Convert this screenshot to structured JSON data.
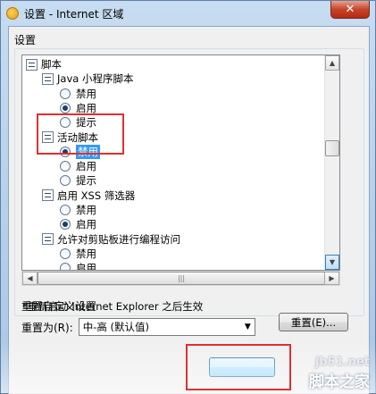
{
  "window": {
    "title": "设置 - Internet 区域",
    "close_symbol": "✕"
  },
  "settings_label": "设置",
  "tree": [
    {
      "type": "section",
      "label": "脚本",
      "indent": 0
    },
    {
      "type": "section",
      "label": "Java 小程序脚本",
      "indent": 1
    },
    {
      "type": "radio",
      "label": "禁用",
      "indent": 2,
      "checked": false
    },
    {
      "type": "radio",
      "label": "启用",
      "indent": 2,
      "checked": true
    },
    {
      "type": "radio",
      "label": "提示",
      "indent": 2,
      "checked": false
    },
    {
      "type": "section",
      "label": "活动脚本",
      "indent": 1
    },
    {
      "type": "radio",
      "label": "禁用",
      "indent": 2,
      "checked": true,
      "selected": true
    },
    {
      "type": "radio",
      "label": "启用",
      "indent": 2,
      "checked": false
    },
    {
      "type": "radio",
      "label": "提示",
      "indent": 2,
      "checked": false
    },
    {
      "type": "section",
      "label": "启用 XSS 筛选器",
      "indent": 1
    },
    {
      "type": "radio",
      "label": "禁用",
      "indent": 2,
      "checked": false
    },
    {
      "type": "radio",
      "label": "启用",
      "indent": 2,
      "checked": true
    },
    {
      "type": "section",
      "label": "允许对剪贴板进行编程访问",
      "indent": 1
    },
    {
      "type": "radio",
      "label": "禁用",
      "indent": 2,
      "checked": false
    },
    {
      "type": "radio",
      "label": "启用",
      "indent": 2,
      "checked": false
    }
  ],
  "note": "*重新启动 Internet Explorer 之后生效",
  "reset_section": {
    "label": "重置自定义设置",
    "reset_to_label": "重置为(R):",
    "selected_level": "中-高 (默认值)",
    "reset_button": "重置(E)..."
  },
  "ok_button": "",
  "watermark": {
    "top": "jb51.net",
    "bottom": "脚本之家"
  },
  "colors": {
    "highlight": "#3399ff",
    "annotation": "#e03030"
  }
}
